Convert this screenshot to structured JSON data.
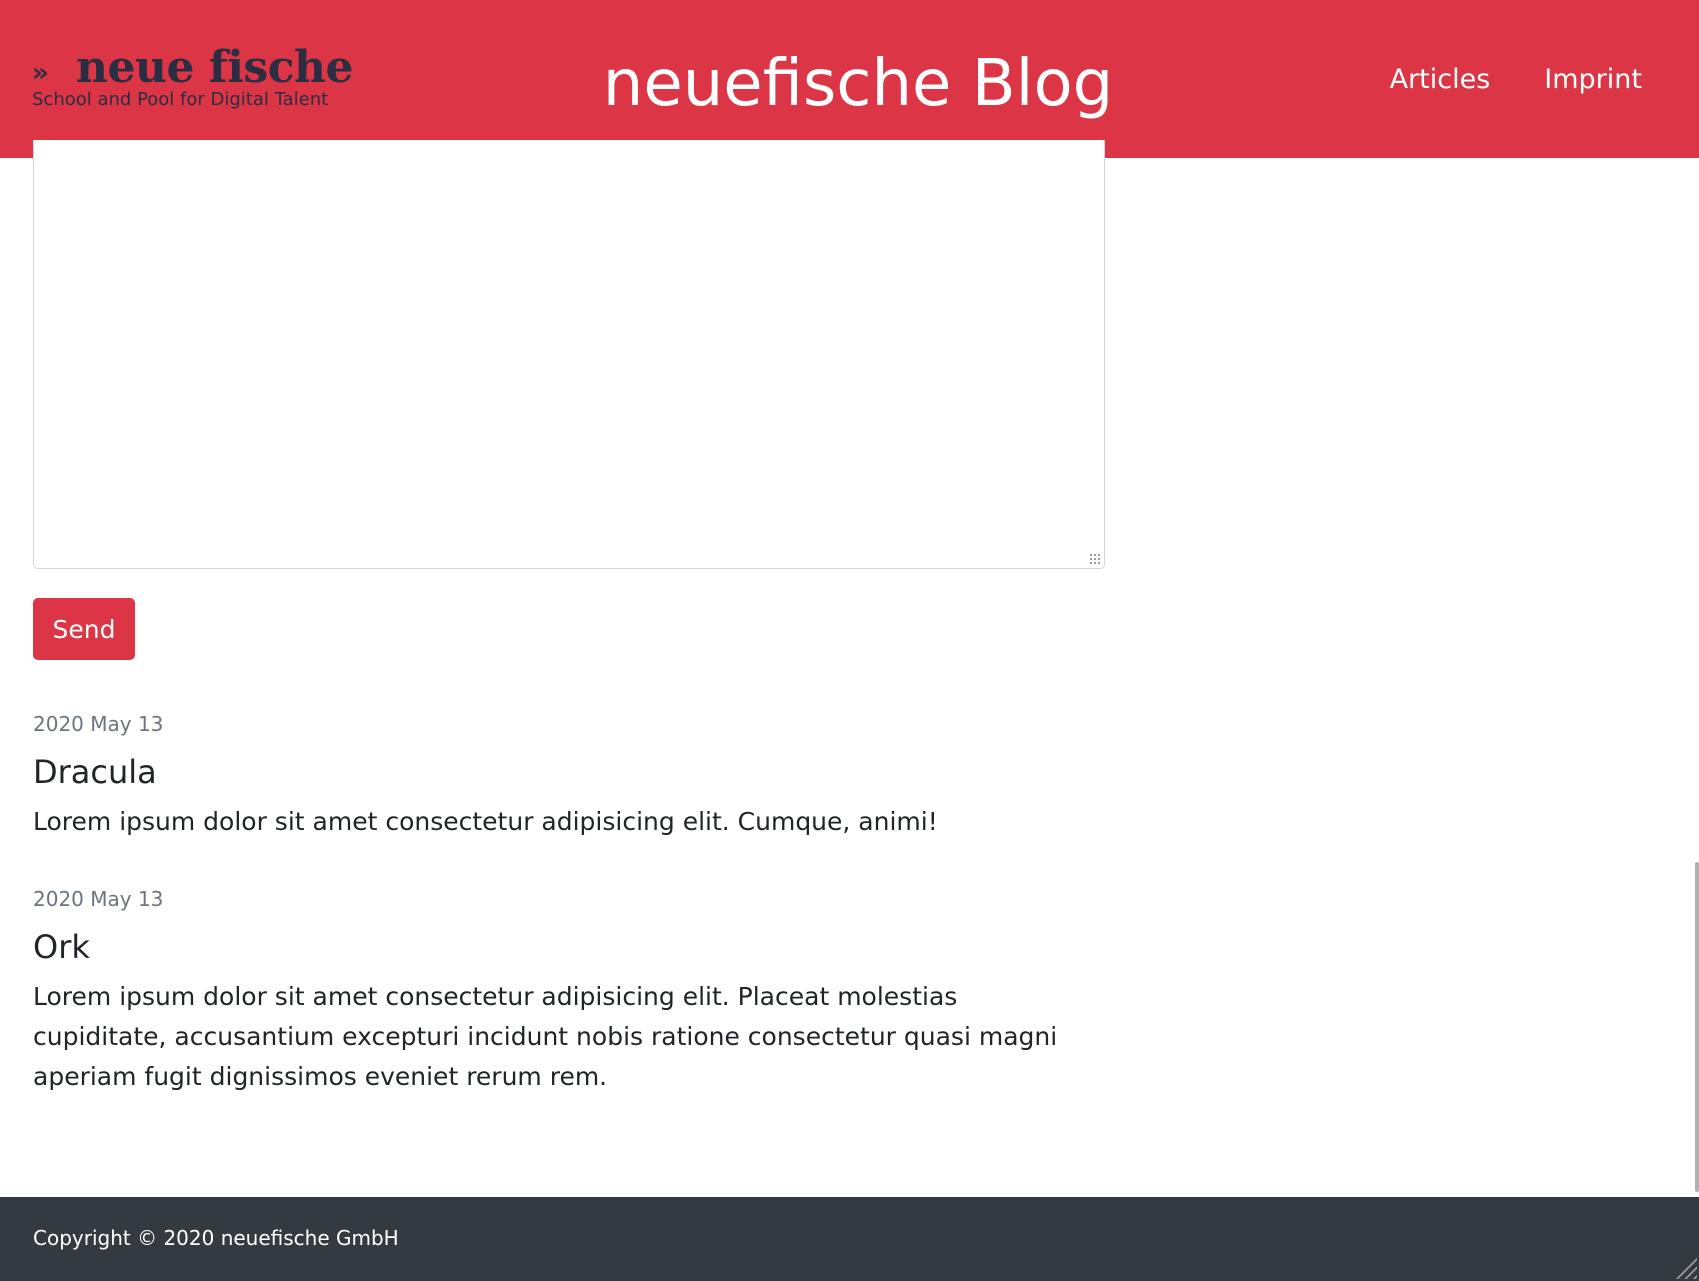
{
  "header": {
    "logo": {
      "name": "neue fische",
      "mark": "»",
      "tagline": "School and Pool for Digital Talent"
    },
    "title": "neuefische Blog",
    "nav": [
      {
        "label": "Articles"
      },
      {
        "label": "Imprint"
      }
    ]
  },
  "form": {
    "textarea_value": "",
    "send_label": "Send"
  },
  "comments": [
    {
      "date": "2020 May 13",
      "author": "Dracula",
      "text": "Lorem ipsum dolor sit amet consectetur adipisicing elit. Cumque, animi!"
    },
    {
      "date": "2020 May 13",
      "author": "Ork",
      "text": "Lorem ipsum dolor sit amet consectetur adipisicing elit. Placeat molestias cupiditate, accusantium excepturi incidunt nobis ratione consectetur quasi magni aperiam fugit dignissimos eveniet rerum rem."
    }
  ],
  "footer": {
    "copyright": "Copyright © 2020 neuefische GmbH"
  },
  "colors": {
    "brand_red": "#dc3545",
    "footer_dark": "#343a40",
    "muted": "#6c757d",
    "logo_navy": "#2b2d42"
  }
}
